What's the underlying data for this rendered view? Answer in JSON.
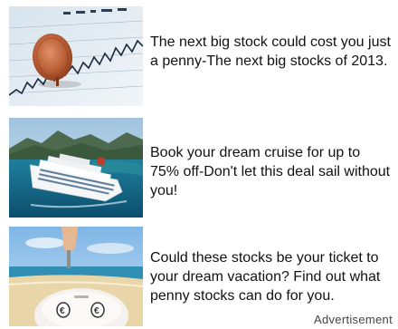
{
  "ads": [
    {
      "image_name": "stock-chart-penny-thumbnail",
      "text": "The next big stock could cost you just a penny-The next big stocks of 2013."
    },
    {
      "image_name": "cruise-ship-thumbnail",
      "text": "Book your dream cruise for up to 75% off-Don't let this deal sail without you!"
    },
    {
      "image_name": "piggy-bank-beach-thumbnail",
      "text": "Could these stocks be your ticket to your dream vacation? Find out what penny stocks can do for you."
    }
  ],
  "footer": {
    "label": "Advertisement"
  }
}
